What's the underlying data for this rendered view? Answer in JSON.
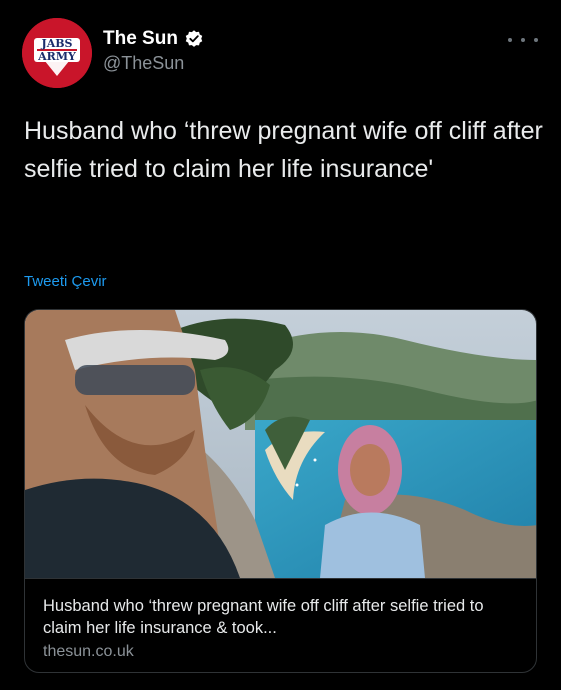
{
  "header": {
    "display_name": "The Sun",
    "handle": "@TheSun",
    "avatar_text_top": "JABS",
    "avatar_text_bottom": "ARMY",
    "avatar_color": "#c9152a",
    "verified_icon": "verified-badge-icon",
    "more_icon": "more-horizontal-icon"
  },
  "tweet": {
    "text": "Husband who ‘threw pregnant wife off cliff after selfie tried to claim her life insurance'",
    "translate_label": "Tweeti Çevir"
  },
  "card": {
    "image_description_icon": "article-photo",
    "title": "Husband who ‘threw pregnant wife off cliff after selfie tried to claim her life insurance & took...",
    "domain": "thesun.co.uk"
  },
  "colors": {
    "background": "#000000",
    "link": "#1d9bf0",
    "secondary_text": "#8b9298",
    "border": "#2f3336"
  }
}
